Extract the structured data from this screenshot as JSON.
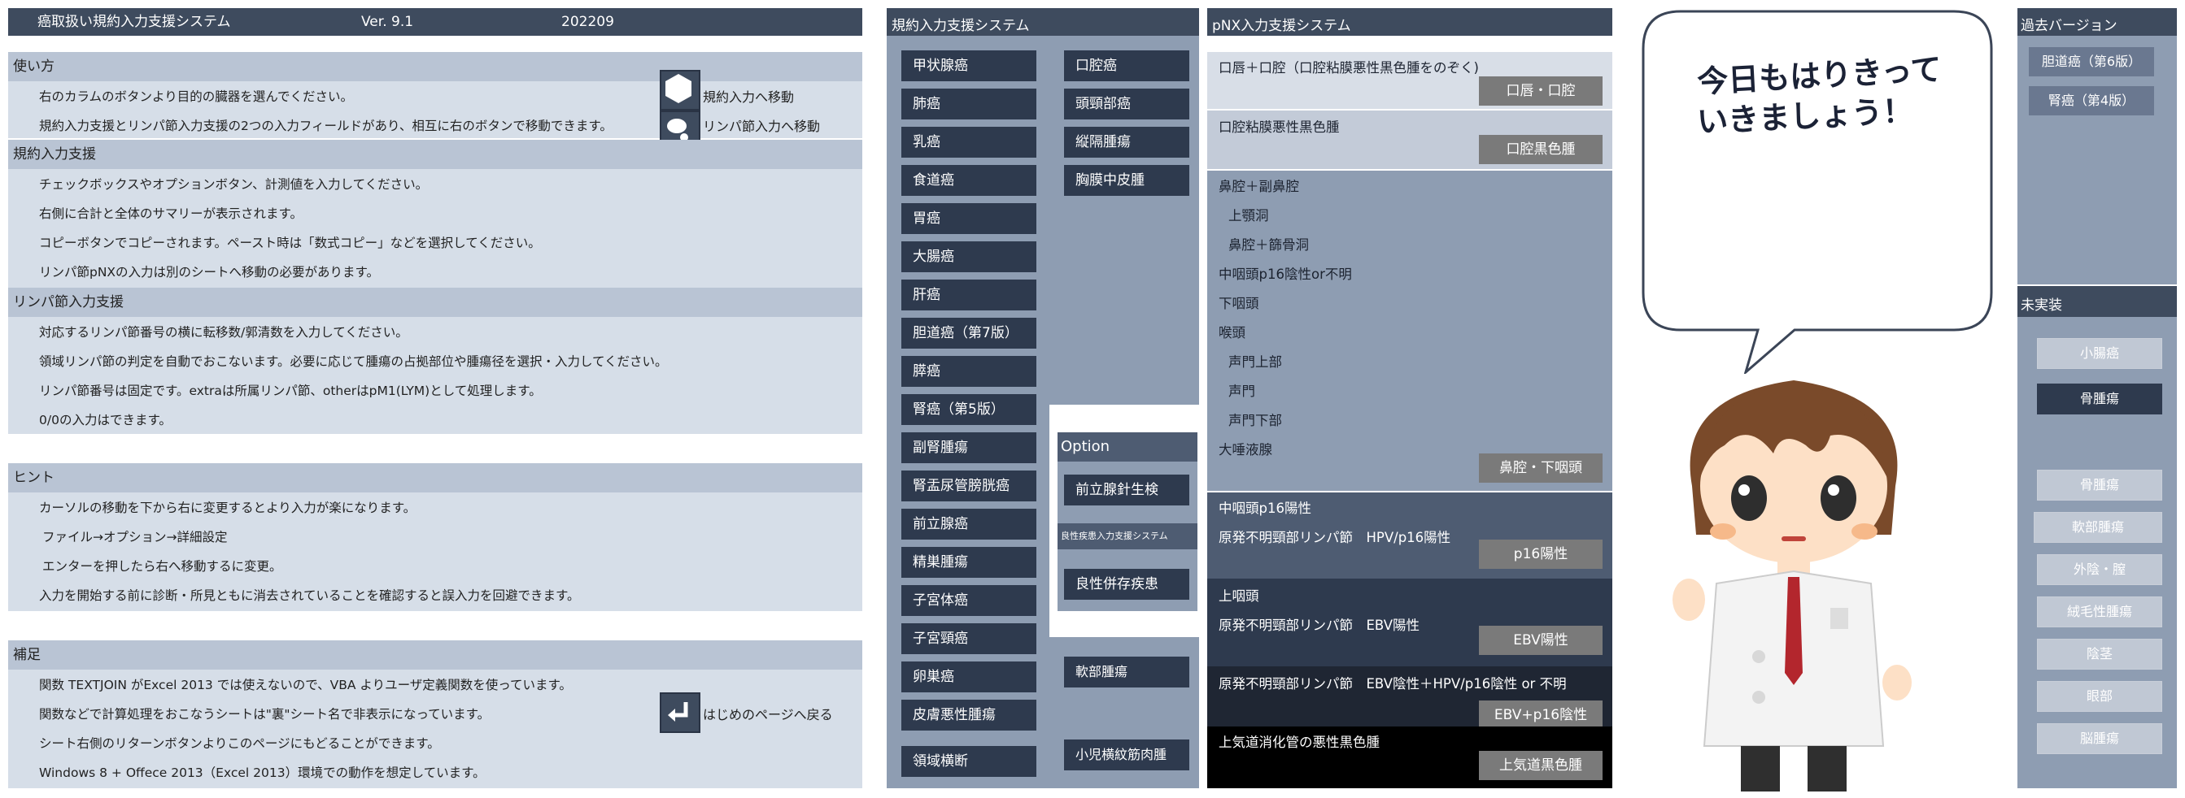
{
  "header": {
    "title": "癌取扱い規約入力支援システム",
    "version": "Ver. 9.1",
    "date": "202209"
  },
  "usage": {
    "title": "使い方",
    "lines": [
      "右のカラムのボタンより目的の臓器を選んでください。",
      "規約入力支援とリンパ節入力支援の2つの入力フィールドがあり、相互に右のボタンで移動できます。"
    ],
    "nav_kiyaku": "規約入力へ移動",
    "nav_lymph": "リンパ節入力へ移動"
  },
  "kiyaku": {
    "title": "規約入力支援",
    "lines": [
      "チェックボックスやオプションボタン、計測値を入力してください。",
      "右側に合計と全体のサマリーが表示されます。",
      "コピーボタンでコピーされます。ペースト時は「数式コピー」などを選択してください。",
      "リンパ節pNXの入力は別のシートへ移動の必要があります。"
    ]
  },
  "lymph": {
    "title": "リンパ節入力支援",
    "lines": [
      "対応するリンパ節番号の横に転移数/郭清数を入力してください。",
      "領域リンパ節の判定を自動でおこないます。必要に応じて腫瘍の占拠部位や腫瘍径を選択・入力してください。",
      "リンパ節番号は固定です。extraは所属リンパ節、otherはpM1(LYM)として処理します。",
      "0/0の入力はできます。"
    ]
  },
  "hint": {
    "title": "ヒント",
    "lines": [
      "カーソルの移動を下から右に変更するとより入力が楽になります。",
      "ファイル→オプション→詳細設定",
      "エンターを押したら右へ移動するに変更。",
      "入力を開始する前に診断・所見ともに消去されていることを確認すると誤入力を回避できます。"
    ]
  },
  "supplement": {
    "title": "補足",
    "lines": [
      "関数 TEXTJOIN がExcel 2013 では使えないので、VBA よりユーザ定義関数を使っています。",
      "関数などで計算処理をおこなうシートは\"裏\"シート名で非表示になっています。",
      "シート右側のリターンボタンよりこのページにもどることができます。",
      "Windows 8 + Offece 2013（Excel 2013）環境での動作を想定しています。"
    ],
    "return_label": "はじめのページへ戻る"
  },
  "middle": {
    "title_kiyaku": "規約入力支援システム",
    "title_pnx": "pNX入力支援システム",
    "organs_col1": [
      "甲状腺癌",
      "肺癌",
      "乳癌",
      "食道癌",
      "胃癌",
      "大腸癌",
      "肝癌",
      "胆道癌（第7版）",
      "膵癌",
      "腎癌（第5版）",
      "副腎腫瘍",
      "腎盂尿管膀胱癌",
      "前立腺癌",
      "精巣腫瘍",
      "子宮体癌",
      "子宮頸癌",
      "卵巣癌",
      "皮膚悪性腫瘍",
      "領域横断"
    ],
    "organs_col2": [
      "口腔癌",
      "頭頸部癌",
      "縦隔腫瘍",
      "胸膜中皮腫"
    ],
    "option_title": "Option",
    "option_btn1": "前立腺針生検",
    "option_sub": "良性疾患入力支援システム",
    "option_btn2": "良性併存疾患",
    "soft_tissue": "軟部腫瘍",
    "rhabdo": "小児横紋筋肉腫"
  },
  "pnx": {
    "s1_text": "口唇＋口腔（口腔粘膜悪性黒色腫をのぞく)",
    "s1_btn": "口唇・口腔",
    "s2_text": "口腔粘膜悪性黒色腫",
    "s2_btn": "口腔黒色腫",
    "s3_lines": [
      "鼻腔＋副鼻腔",
      "上顎洞",
      "鼻腔＋篩骨洞",
      "中咽頭p16陰性or不明",
      "下咽頭",
      "喉頭",
      "声門上部",
      "声門",
      "声門下部",
      "大唾液腺"
    ],
    "s3_btn": "鼻腔・下咽頭",
    "s4_lines": [
      "中咽頭p16陽性",
      "原発不明頸部リンパ節　HPV/p16陽性"
    ],
    "s4_btn": "p16陽性",
    "s5_lines": [
      "上咽頭",
      "原発不明頸部リンパ節　EBV陽性"
    ],
    "s5_btn": "EBV陽性",
    "s6_text": "原発不明頸部リンパ節　EBV陰性＋HPV/p16陰性 or 不明",
    "s6_btn": "EBV+p16陰性",
    "s7_text": "上気道消化管の悪性黒色腫",
    "s7_btn": "上気道黒色腫"
  },
  "speech": {
    "text_line1": "今日もはりきって",
    "text_line2": "いきましょう！"
  },
  "right": {
    "past_title": "過去バージョン",
    "past_items": [
      "胆道癌（第6版）",
      "腎癌（第4版）"
    ],
    "unimpl_title": "未実装",
    "unimpl_items": [
      "小腸癌",
      "骨腫瘍",
      "骨腫瘍",
      "軟部腫瘍",
      "外陰・膣",
      "絨毛性腫瘍",
      "陰茎",
      "眼部",
      "脳腫瘍"
    ]
  }
}
